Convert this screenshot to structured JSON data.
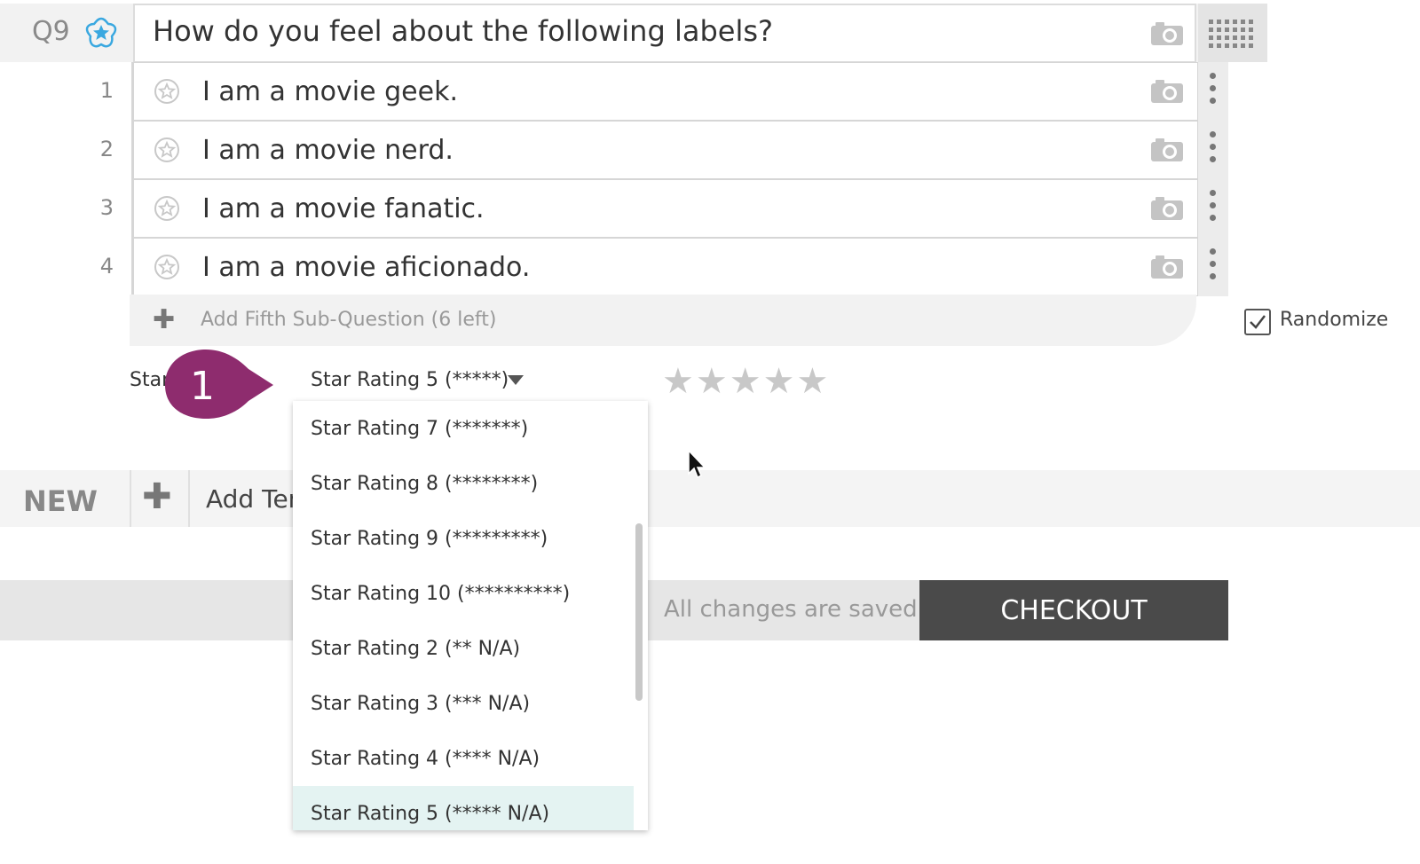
{
  "question": {
    "number": "Q9",
    "text": "How do you feel about the following labels?"
  },
  "sub_questions": [
    {
      "num": "1",
      "text": "I am a movie geek."
    },
    {
      "num": "2",
      "text": "I am a movie nerd."
    },
    {
      "num": "3",
      "text": "I am a movie fanatic."
    },
    {
      "num": "4",
      "text": "I am a movie aficionado."
    }
  ],
  "add_sub_question_label": "Add Fifth Sub-Question (6 left)",
  "randomize": {
    "label": "Randomize",
    "checked": true
  },
  "star_type": {
    "label": "Star",
    "callout_number": "1",
    "selected_value": "Star Rating 5 (*****)",
    "preview_star_count": 5
  },
  "dropdown": {
    "options": [
      "Star Rating 7 (*******)",
      "Star Rating 8 (********)",
      "Star Rating 9 (*********)",
      "Star Rating 10 (**********)",
      "Star Rating 2 (** N/A)",
      "Star Rating 3 (*** N/A)",
      "Star Rating 4 (**** N/A)",
      "Star Rating 5 (***** N/A)"
    ],
    "highlighted_index": 7
  },
  "new_row": {
    "label": "NEW",
    "add_label": "Add Ten"
  },
  "footer": {
    "saved_text": "All changes are saved!",
    "checkout_label": "CHECKOUT"
  },
  "colors": {
    "accent_blue": "#3aa8e0",
    "callout_purple": "#8e2c6e",
    "checkout_bg": "#4a4a4a",
    "highlight": "#e4f3f2"
  }
}
